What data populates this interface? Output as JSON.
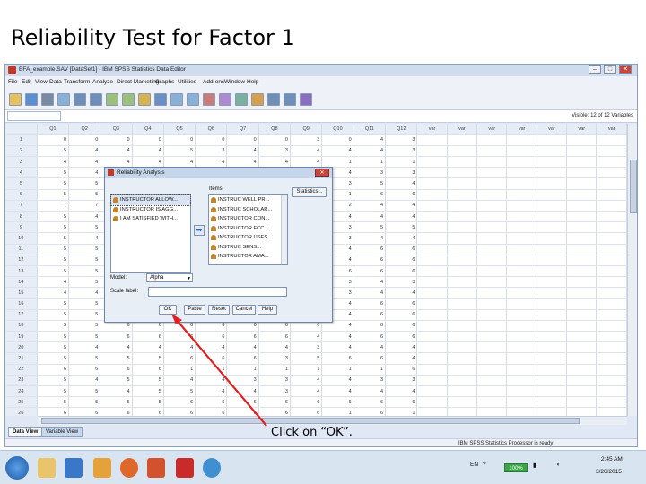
{
  "slide": {
    "title": "Reliability Test for Factor 1",
    "annotation": "Click on “OK”."
  },
  "window": {
    "title": "EFA_example.SAV [DataSet1] - IBM SPSS Statistics Data Editor",
    "controls": [
      "–",
      "□",
      "✕"
    ]
  },
  "menu": [
    "File",
    "Edit",
    "View",
    "Data",
    "Transform",
    "Analyze",
    "Direct Marketing",
    "Graphs",
    "Utilities",
    "Add-ons",
    "Window",
    "Help"
  ],
  "toolbar": {
    "icons": [
      "open-icon",
      "save-icon",
      "print-icon",
      "dialog-recall-icon",
      "undo-icon",
      "redo-icon",
      "goto-case-icon",
      "goto-variable-icon",
      "variables-icon",
      "find-icon",
      "insert-cases-icon",
      "insert-variable-icon",
      "split-file-icon",
      "weight-cases-icon",
      "select-cases-icon",
      "value-labels-icon",
      "use-sets-icon",
      "show-all-icon",
      "spell-icon"
    ]
  },
  "input_row": {
    "visible": "Visible: 12 of 12 Variables"
  },
  "grid": {
    "columns": [
      "Q1",
      "Q2",
      "Q3",
      "Q4",
      "Q5",
      "Q6",
      "Q7",
      "Q8",
      "Q9",
      "Q10",
      "Q11",
      "Q12",
      "var",
      "var",
      "var",
      "var",
      "var",
      "var",
      "var"
    ],
    "rows": [
      {
        "n": "1",
        "v": [
          "0",
          "0",
          "0",
          "0",
          "0",
          "0",
          "0",
          "0",
          "3",
          "0",
          "4",
          "3"
        ]
      },
      {
        "n": "2",
        "v": [
          "5",
          "4",
          "4",
          "4",
          "5",
          "3",
          "4",
          "3",
          "4",
          "4",
          "4",
          "3"
        ]
      },
      {
        "n": "3",
        "v": [
          "4",
          "4",
          "4",
          "4",
          "4",
          "4",
          "4",
          "4",
          "4",
          "1",
          "1",
          "1"
        ]
      },
      {
        "n": "4",
        "v": [
          "5",
          "4",
          "",
          "",
          "",
          "",
          "",
          "",
          "",
          "4",
          "3",
          "3"
        ]
      },
      {
        "n": "5",
        "v": [
          "5",
          "5",
          "",
          "",
          "",
          "",
          "",
          "",
          "",
          "3",
          "5",
          "4"
        ]
      },
      {
        "n": "6",
        "v": [
          "5",
          "5",
          "",
          "",
          "",
          "",
          "",
          "",
          "",
          "1",
          "6",
          "6"
        ]
      },
      {
        "n": "7",
        "v": [
          "7",
          "7",
          "",
          "",
          "",
          "",
          "",
          "",
          "",
          "2",
          "4",
          "4"
        ]
      },
      {
        "n": "8",
        "v": [
          "5",
          "4",
          "",
          "",
          "",
          "",
          "",
          "",
          "",
          "4",
          "4",
          "4"
        ]
      },
      {
        "n": "9",
        "v": [
          "5",
          "5",
          "",
          "",
          "",
          "",
          "",
          "",
          "",
          "3",
          "5",
          "5"
        ]
      },
      {
        "n": "10",
        "v": [
          "5",
          "4",
          "",
          "",
          "",
          "",
          "",
          "",
          "",
          "3",
          "4",
          "4"
        ]
      },
      {
        "n": "11",
        "v": [
          "5",
          "5",
          "",
          "",
          "",
          "",
          "",
          "",
          "",
          "4",
          "6",
          "6"
        ]
      },
      {
        "n": "12",
        "v": [
          "5",
          "5",
          "",
          "",
          "",
          "",
          "",
          "",
          "",
          "4",
          "6",
          "6"
        ]
      },
      {
        "n": "13",
        "v": [
          "5",
          "5",
          "",
          "",
          "",
          "",
          "",
          "",
          "",
          "6",
          "6",
          "6"
        ]
      },
      {
        "n": "14",
        "v": [
          "4",
          "5",
          "",
          "",
          "",
          "",
          "",
          "",
          "",
          "3",
          "4",
          "3"
        ]
      },
      {
        "n": "15",
        "v": [
          "4",
          "4",
          "",
          "",
          "",
          "",
          "",
          "",
          "",
          "3",
          "4",
          "4"
        ]
      },
      {
        "n": "16",
        "v": [
          "5",
          "5",
          "",
          "",
          "",
          "",
          "",
          "",
          "",
          "4",
          "6",
          "6"
        ]
      },
      {
        "n": "17",
        "v": [
          "5",
          "5",
          "",
          "",
          "",
          "",
          "",
          "",
          "",
          "4",
          "6",
          "6"
        ]
      },
      {
        "n": "18",
        "v": [
          "5",
          "5",
          "6",
          "6",
          "6",
          "6",
          "6",
          "6",
          "6",
          "4",
          "6",
          "6"
        ]
      },
      {
        "n": "19",
        "v": [
          "5",
          "5",
          "6",
          "6",
          "6",
          "6",
          "6",
          "6",
          "4",
          "4",
          "6",
          "6"
        ]
      },
      {
        "n": "20",
        "v": [
          "5",
          "4",
          "4",
          "4",
          "4",
          "4",
          "4",
          "4",
          "3",
          "4",
          "4",
          "4"
        ]
      },
      {
        "n": "21",
        "v": [
          "5",
          "5",
          "5",
          "5",
          "6",
          "6",
          "6",
          "3",
          "5",
          "6",
          "6",
          "4"
        ]
      },
      {
        "n": "22",
        "v": [
          "6",
          "6",
          "6",
          "6",
          "1",
          "1",
          "1",
          "1",
          "1",
          "1",
          "1",
          "6"
        ]
      },
      {
        "n": "23",
        "v": [
          "5",
          "4",
          "5",
          "5",
          "4",
          "4",
          "3",
          "3",
          "4",
          "4",
          "3",
          "3"
        ]
      },
      {
        "n": "24",
        "v": [
          "5",
          "5",
          "4",
          "5",
          "5",
          "4",
          "4",
          "3",
          "4",
          "4",
          "4",
          "4"
        ]
      },
      {
        "n": "25",
        "v": [
          "5",
          "5",
          "5",
          "5",
          "6",
          "6",
          "6",
          "6",
          "6",
          "6",
          "6",
          "6"
        ]
      },
      {
        "n": "26",
        "v": [
          "6",
          "6",
          "6",
          "6",
          "6",
          "6",
          "6",
          "6",
          "6",
          "1",
          "6",
          "1"
        ]
      }
    ]
  },
  "tabs": {
    "data_view": "Data View",
    "variable_view": "Variable View"
  },
  "status": "IBM SPSS Statistics Processor is ready",
  "dialog": {
    "title": "Reliability Analysis",
    "source_items": [
      "INSTRUCTOR ALLOW...",
      "INSTRUCTOR IS AGG...",
      "I AM SATISFIED WITH..."
    ],
    "items_label": "Items:",
    "target_items": [
      "INSTRUC WELL PR...",
      "INSTRUC SCHOLAR...",
      "INSTRUCTOR CON...",
      "INSTRUCTOR FCC...",
      "INSTRUCTOR USES...",
      "INSTRUC SENS...",
      "INSTRUCTOR AMA..."
    ],
    "statistics_button": "Statistics...",
    "model_label": "Model:",
    "model_value": "Alpha",
    "scale_label_label": "Scale label:",
    "scale_label_value": "",
    "buttons": {
      "ok": "OK",
      "paste": "Paste",
      "reset": "Reset",
      "cancel": "Cancel",
      "help": "Help"
    }
  },
  "tray": {
    "lang": "EN",
    "battery": "100%",
    "time": "2:45 AM",
    "date": "3/26/2015"
  },
  "colors": {
    "arrow": "#e02020",
    "selection": "#d9e4f3"
  }
}
